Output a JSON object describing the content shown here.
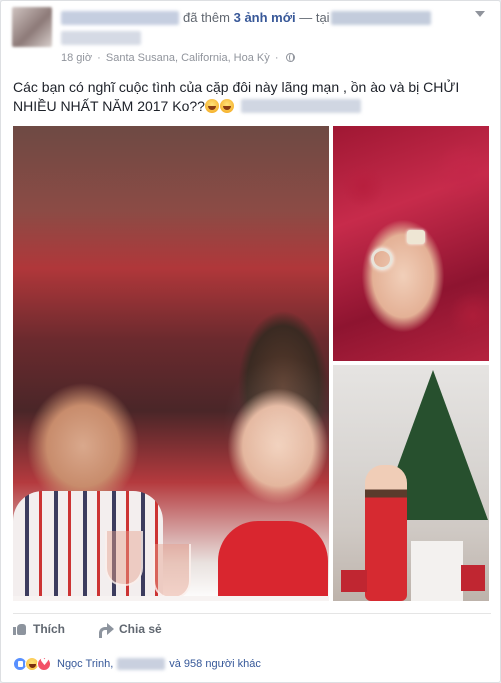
{
  "header": {
    "added_prefix": "đã thêm",
    "added_count": "3 ảnh mới",
    "at_label": "— tại",
    "time": "18 giờ",
    "location": "Santa Susana, California, Hoa Kỳ",
    "separator": "·"
  },
  "post": {
    "text_line": "Các bạn có nghĩ cuộc tình của cặp đôi này lãng mạn , ồn ào và bị CHỬI NHIỀU NHẤT NĂM 2017 Ko??"
  },
  "icons": {
    "avatar": "avatar-blurred",
    "globe": "globe-icon",
    "menu": "chevron-down-icon",
    "like": "thumbs-up-icon",
    "share": "share-arrow-icon",
    "emoji": "laughing-emoji-icon"
  },
  "actions": {
    "like_label": "Thích",
    "share_label": "Chia sẻ"
  },
  "reactions": {
    "first_name": "Ngọc Trinh,",
    "rest": "và 958 người khác"
  },
  "colors": {
    "link": "#365899",
    "muted": "#90949c",
    "like_blue": "#5890ff",
    "love_red": "#f25268",
    "haha_yellow": "#f7b633"
  }
}
